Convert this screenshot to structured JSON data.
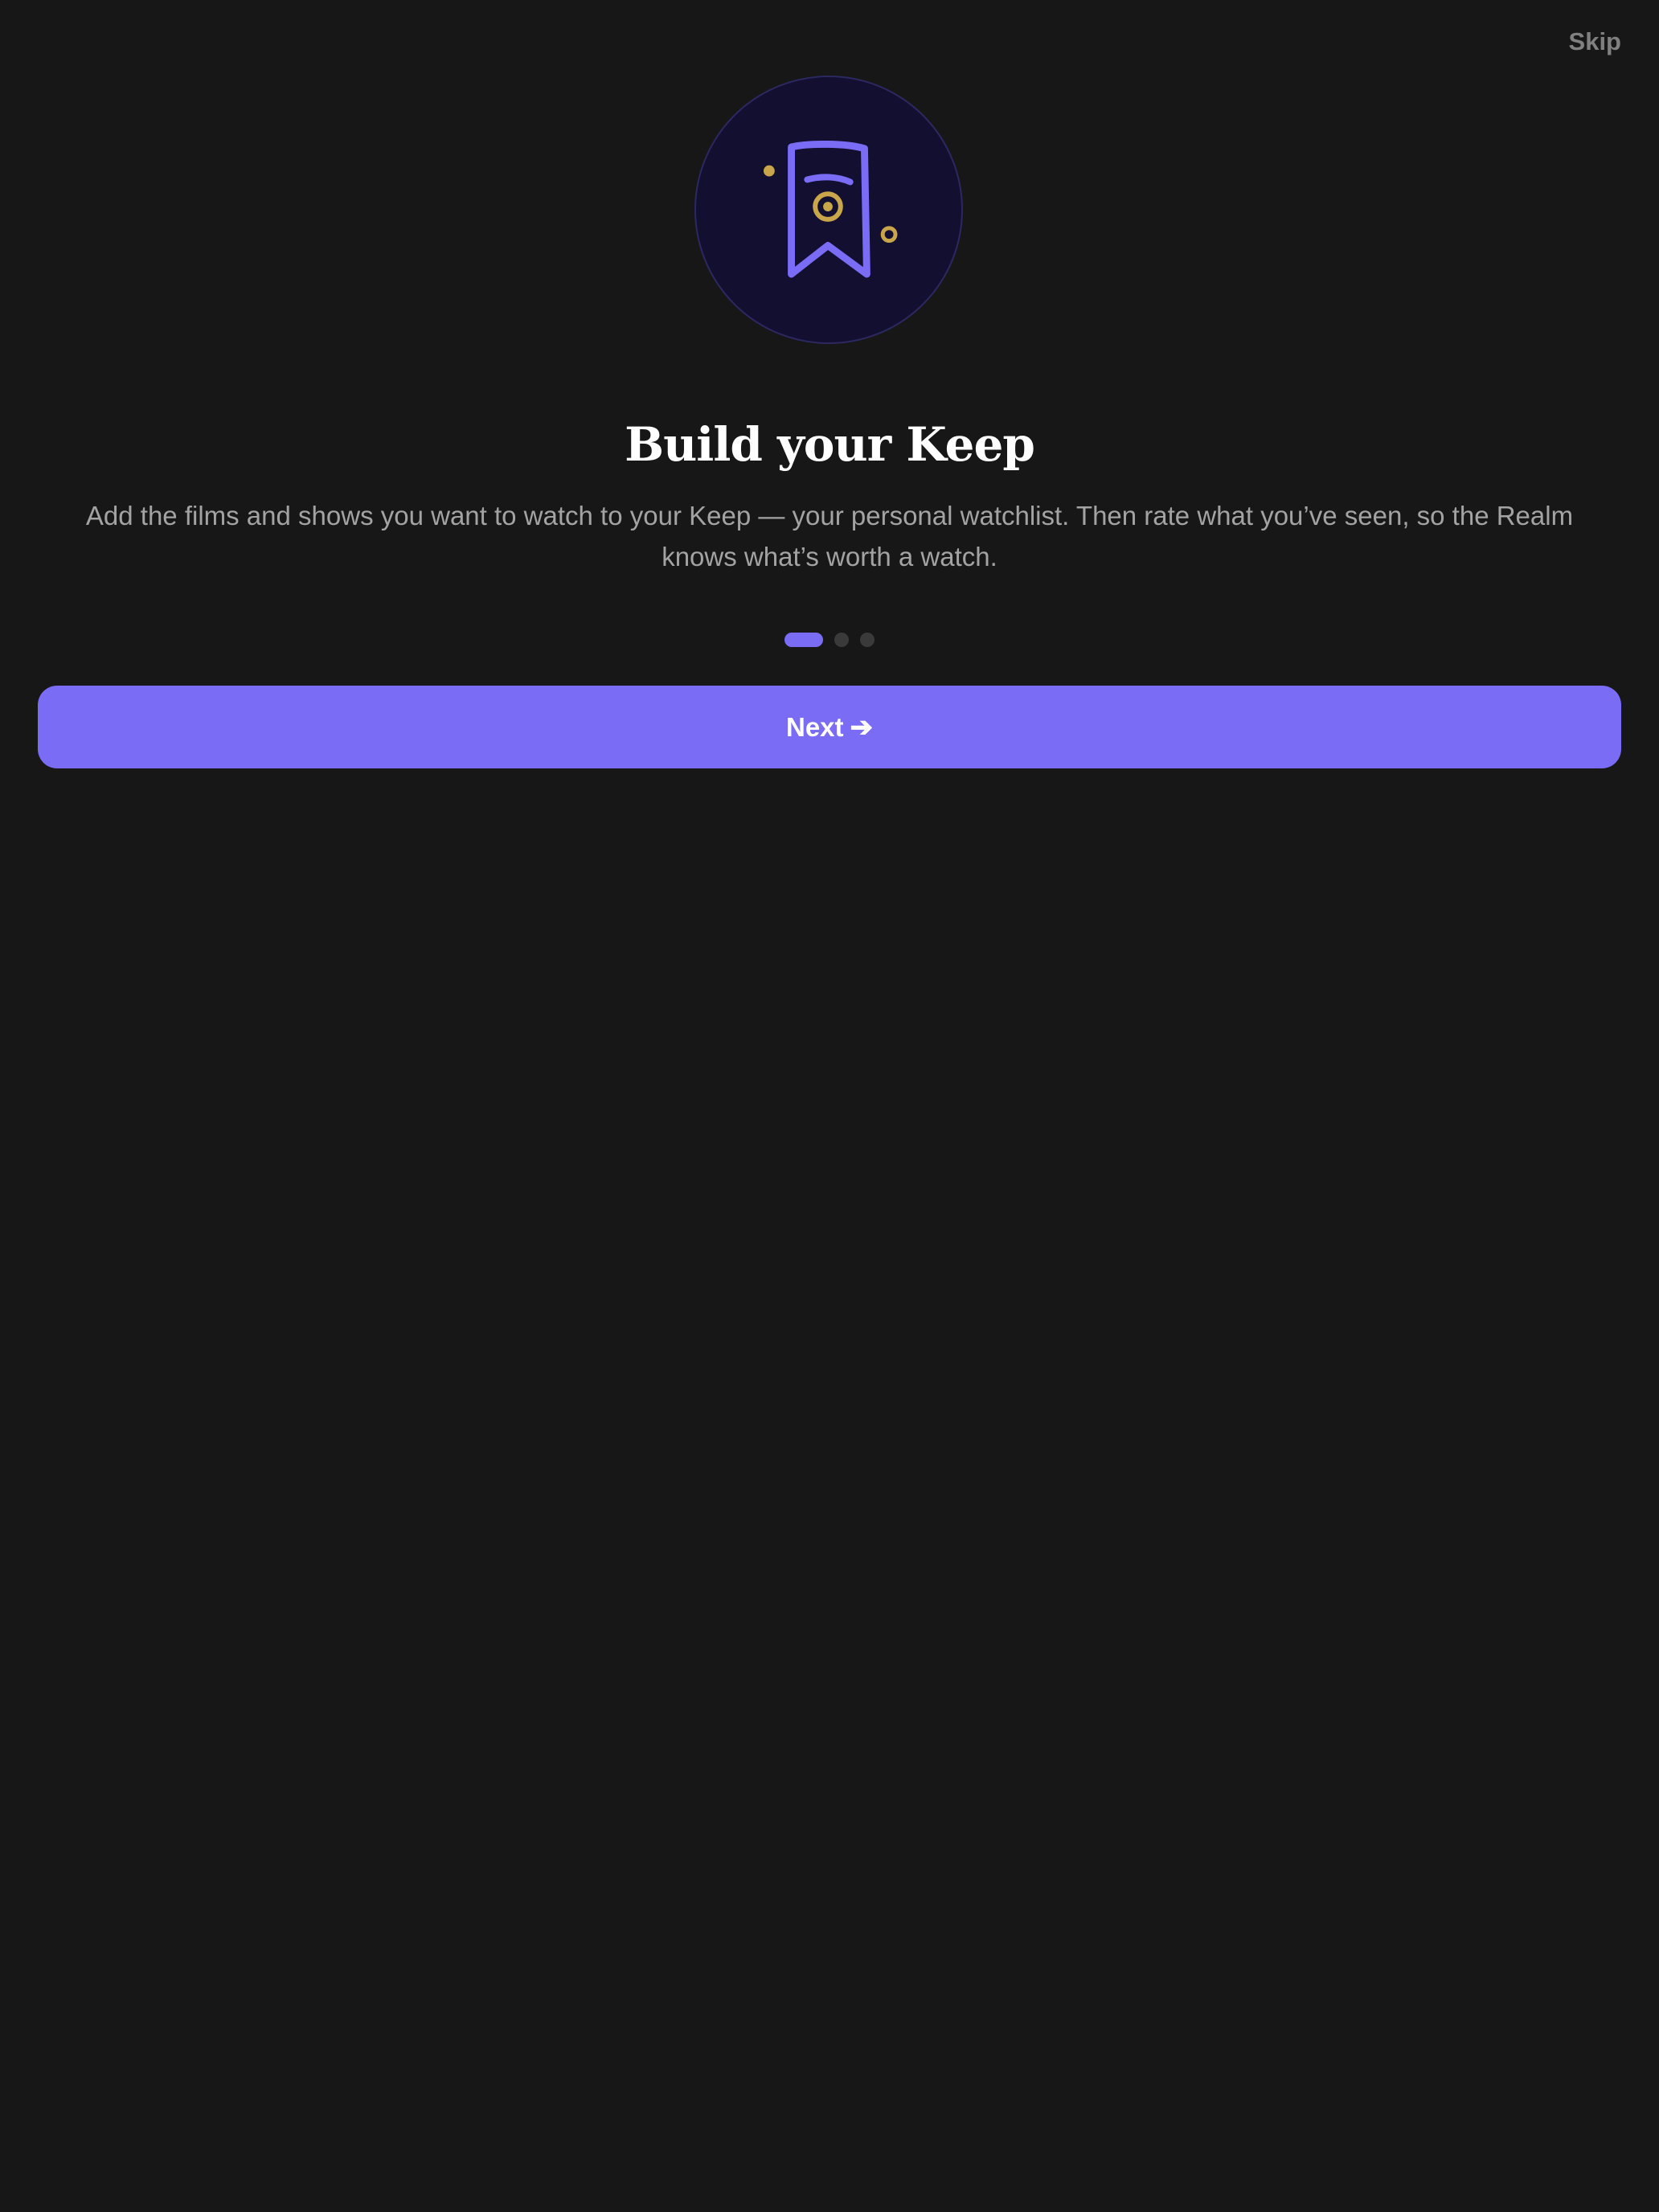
{
  "header": {
    "skip_label": "Skip"
  },
  "onboarding": {
    "icon": "bookmark-icon",
    "title": "Build your Keep",
    "description": "Add the films and shows you want to watch to your Keep — your personal watchlist. Then rate what you’ve seen, so the Realm knows what’s worth a watch.",
    "step_indicator": {
      "current": 1,
      "total": 3
    },
    "next_label": "Next",
    "next_icon": "arrow-right-icon"
  },
  "colors": {
    "background": "#171717",
    "accent": "#7b6cf6",
    "gold": "#c9a64a",
    "hero_bg": "#120f31",
    "muted_text": "#a3a3a3",
    "skip_text": "#808080",
    "inactive_dot": "#3a3a3a"
  }
}
